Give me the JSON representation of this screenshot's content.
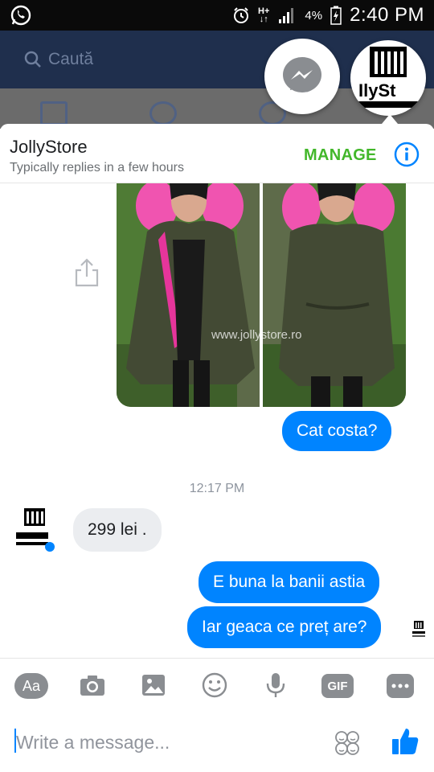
{
  "status_bar": {
    "time": "2:40 PM",
    "battery_percent": "4%",
    "network": "H+"
  },
  "background_app": {
    "search_placeholder": "Caută"
  },
  "chat": {
    "store_name": "JollyStore",
    "reply_status": "Typically replies in a few hours",
    "manage_label": "MANAGE",
    "photo_watermark": "www.jollystore.ro",
    "messages": [
      {
        "from": "me",
        "text": "Cat costa?"
      },
      {
        "from": "store",
        "text": "299 lei ."
      },
      {
        "from": "me",
        "text": "E buna la banii astia"
      },
      {
        "from": "me",
        "text": "Iar geaca ce preț are?"
      }
    ],
    "timestamp": "12:17 PM"
  },
  "chathead_logo_text": "IlySt",
  "composer": {
    "aa_label": "Aa",
    "gif_label": "GIF",
    "placeholder": "Write a message..."
  },
  "colors": {
    "messenger_blue": "#0084ff",
    "manage_green": "#42b72a",
    "fb_header": "#1f2f4d"
  },
  "icons": [
    "whatsapp-icon",
    "alarm-icon",
    "signal-icon",
    "battery-icon",
    "search-icon",
    "messenger-icon",
    "info-icon",
    "share-icon",
    "camera-icon",
    "image-icon",
    "emoji-icon",
    "microphone-icon",
    "more-icon",
    "sticker-icon",
    "like-icon"
  ]
}
